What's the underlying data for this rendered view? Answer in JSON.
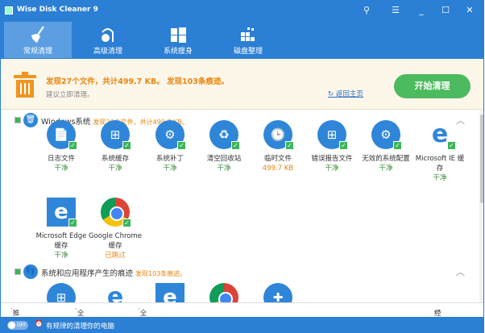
{
  "window": {
    "title": "Wise Disk Cleaner 9"
  },
  "nav": {
    "tabs": [
      {
        "label": "常规清理"
      },
      {
        "label": "高级清理"
      },
      {
        "label": "系统瘦身"
      },
      {
        "label": "磁盘整理"
      }
    ]
  },
  "banner": {
    "found": "发现27个文件，共计499.7 KB。 发现103条痕迹。",
    "advice": "建议立即清理。",
    "back": "返回主页",
    "start": "开始清理"
  },
  "sections": [
    {
      "title": "Windows系统",
      "summary": "发现26个文件，共计499.7 KB。",
      "items": [
        {
          "label": "日志文件",
          "status": "干净",
          "icon": "📄"
        },
        {
          "label": "系统缓存",
          "status": "干净",
          "icon": "⊞"
        },
        {
          "label": "系统补丁",
          "status": "干净",
          "icon": "⚙"
        },
        {
          "label": "清空回收站",
          "status": "干净",
          "icon": "♻"
        },
        {
          "label": "临时文件",
          "status": "499.7 KB",
          "icon": "🕒"
        },
        {
          "label": "错误报告文件",
          "status": "干净",
          "icon": "⊞"
        },
        {
          "label": "无效的系统配置",
          "status": "干净",
          "icon": "⚙"
        },
        {
          "label": "Microsoft IE 缓存",
          "status": "干净",
          "icon": "e"
        },
        {
          "label": "Microsoft Edge 缓存",
          "status": "干净",
          "icon": "e"
        },
        {
          "label": "Google Chrome缓存",
          "status": "已跳过",
          "icon": ""
        }
      ]
    },
    {
      "title": "系统和应用程序产生的痕迹",
      "summary": "发现103条痕迹。"
    }
  ],
  "footer": {
    "recommend": "推荐",
    "select_all": "全选",
    "select_none": "全不选",
    "classic": "经典模式"
  },
  "bottom": {
    "toggle": "OFF",
    "schedule": "有规律的清理你的电脑"
  }
}
